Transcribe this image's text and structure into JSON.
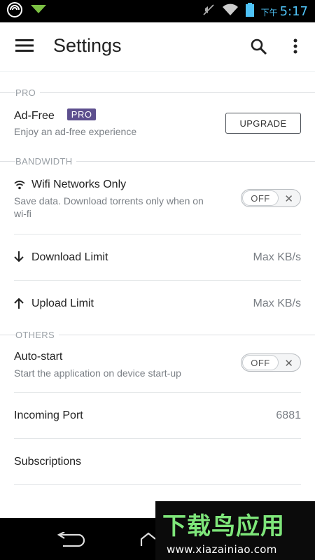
{
  "status_bar": {
    "ampm": "下午",
    "time": "5:17"
  },
  "app_bar": {
    "title": "Settings"
  },
  "sections": {
    "pro": "PRO",
    "bandwidth": "BANDWIDTH",
    "others": "OTHERS"
  },
  "ad_free": {
    "title": "Ad-Free",
    "badge": "PRO",
    "subtitle": "Enjoy an ad-free experience",
    "button": "UPGRADE"
  },
  "wifi_only": {
    "title": "Wifi Networks Only",
    "subtitle_line1": "Save data. Download torrents only when on",
    "subtitle_line2": "wi-fi",
    "toggle_label": "OFF"
  },
  "download_limit": {
    "title": "Download Limit",
    "value": "Max KB/s"
  },
  "upload_limit": {
    "title": "Upload Limit",
    "value": "Max KB/s"
  },
  "auto_start": {
    "title": "Auto-start",
    "subtitle": "Start the application on device start-up",
    "toggle_label": "OFF"
  },
  "incoming_port": {
    "title": "Incoming Port",
    "value": "6881"
  },
  "subscriptions": {
    "title": "Subscriptions"
  },
  "watermark": {
    "logo": "下载鸟应用",
    "url": "www.xiazainiao.com"
  },
  "colors": {
    "pro_badge": "#5d4f8e",
    "status_time": "#4fc3f7",
    "watermark_logo": "#7ee67a"
  }
}
